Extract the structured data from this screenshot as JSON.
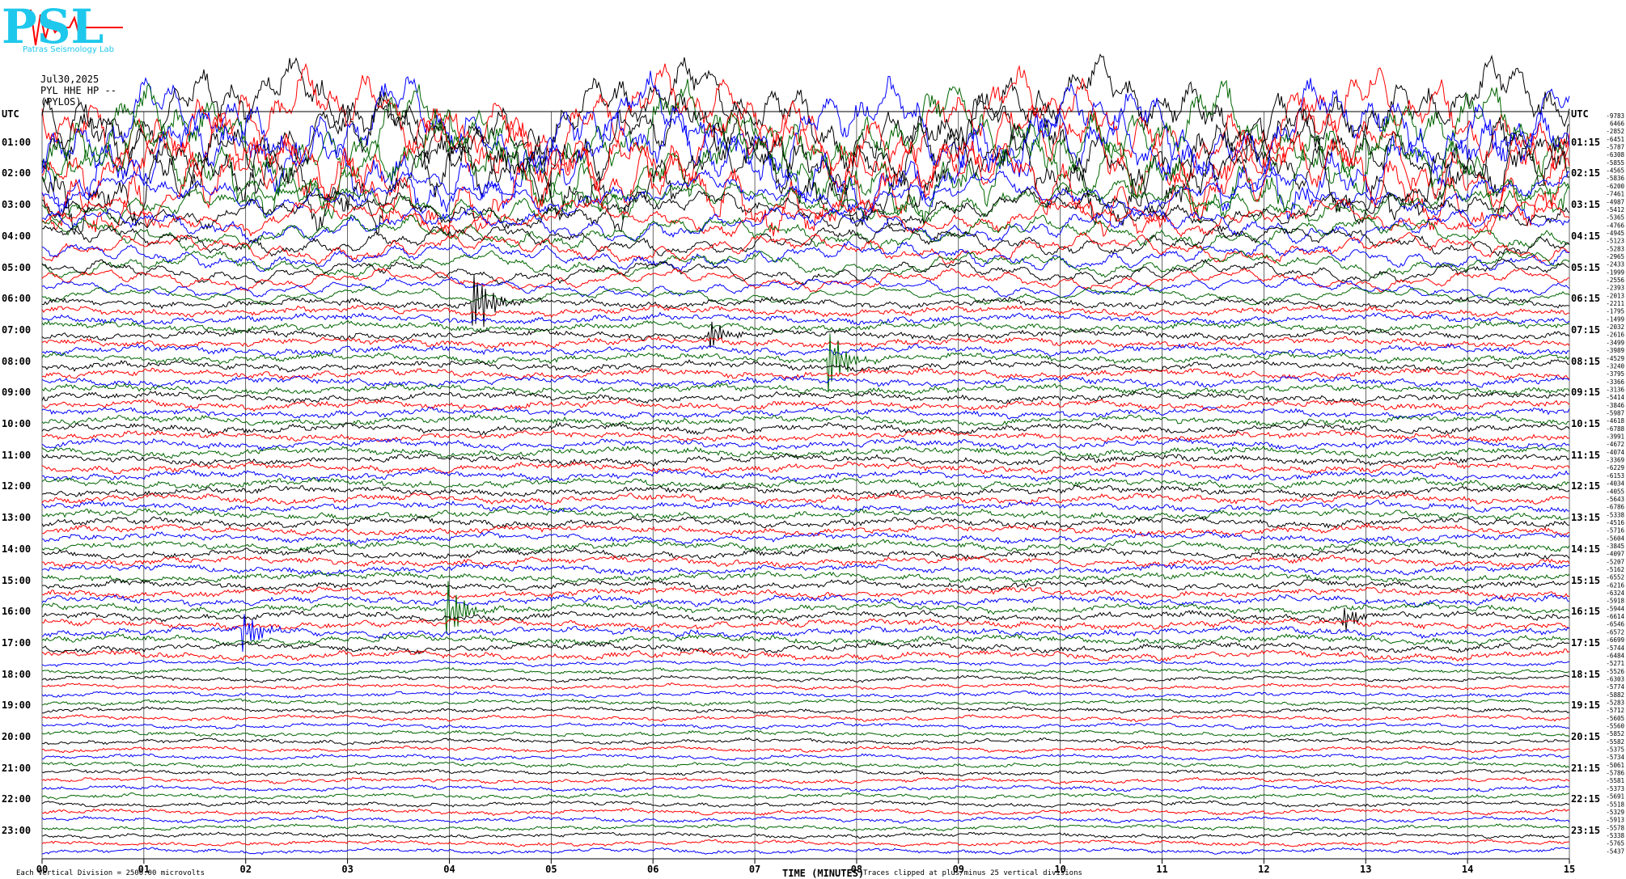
{
  "header": {
    "logo_text": "PSL",
    "logo_sub": "Patras Seismology Lab",
    "date": "Jul30,2025",
    "station": "PYL HHE HP --",
    "location": "(PYLOS)",
    "utc_left": "UTC",
    "utc_right": "UTC"
  },
  "footer": {
    "scale_note": "Each Vertical Division = 2500.00 microvolts",
    "clip_note": "Traces clipped at plus/minus 25 vertical divisions",
    "x_title": "TIME (MINUTES)"
  },
  "colors": {
    "black": "#000000",
    "red": "#ff0000",
    "blue": "#0000ff",
    "green": "#006600",
    "logo": "#1ec8ec",
    "grid": "#000000"
  },
  "chart_data": {
    "type": "line",
    "subtype": "helicorder",
    "x_ticks": [
      "00",
      "01",
      "02",
      "03",
      "04",
      "05",
      "06",
      "07",
      "08",
      "09",
      "10",
      "11",
      "12",
      "13",
      "14",
      "15"
    ],
    "xlim": [
      0,
      15
    ],
    "left_hour_labels": [
      "01:00",
      "02:00",
      "03:00",
      "04:00",
      "05:00",
      "06:00",
      "07:00",
      "08:00",
      "09:00",
      "10:00",
      "11:00",
      "12:00",
      "13:00",
      "14:00",
      "15:00",
      "16:00",
      "17:00",
      "18:00",
      "19:00",
      "20:00",
      "21:00",
      "22:00",
      "23:00"
    ],
    "right_hour_labels": [
      "01:15",
      "02:15",
      "03:15",
      "04:15",
      "05:15",
      "06:15",
      "07:15",
      "08:15",
      "09:15",
      "10:15",
      "11:15",
      "12:15",
      "13:15",
      "14:15",
      "15:15",
      "16:15",
      "17:15",
      "18:15",
      "19:15",
      "20:15",
      "21:15",
      "22:15",
      "23:15"
    ],
    "trace_colors": [
      "black",
      "red",
      "blue",
      "green"
    ],
    "trace_offsets": [
      -9783,
      6466,
      -2852,
      -6451,
      -5787,
      -6308,
      -5855,
      -4565,
      -5836,
      -6200,
      -7461,
      -4987,
      -5412,
      -5365,
      -4766,
      -4945,
      -5123,
      -5283,
      -2965,
      -2433,
      -1999,
      -2556,
      -2393,
      -2013,
      -2211,
      -1795,
      -1499,
      -2032,
      -2616,
      -3499,
      -3989,
      -4529,
      -3240,
      -3795,
      -3366,
      -3136,
      -5414,
      -3846,
      -5987,
      -4618,
      -6788,
      -3991,
      -4672,
      -4074,
      -3369,
      -6229,
      -6153,
      -4034,
      -4055,
      -5643,
      -6786,
      -5338,
      -4516,
      -5716,
      -5604,
      -3845,
      -4097,
      -5207,
      -5162,
      -6552,
      -6216,
      -6324,
      -5918,
      -5944,
      -6614,
      -6546,
      -6572,
      -6699,
      -5744,
      -6484,
      -5271,
      -5526,
      -6303,
      -5774,
      -5882,
      -5283,
      -5712,
      -5605,
      -5560,
      -5852,
      -5582,
      -5375,
      -5734,
      -5061,
      -5786,
      -5581,
      -5373,
      -5691,
      -5518,
      -5329,
      -5913,
      -5578,
      -5338,
      -5765,
      -5437
    ],
    "events": [
      {
        "trace": 24,
        "minute": 4.25,
        "amplitude": 3.0
      },
      {
        "trace": 28,
        "minute": 6.55,
        "amplitude": 1.2
      },
      {
        "trace": 31,
        "minute": 7.75,
        "amplitude": 2.4
      },
      {
        "trace": 63,
        "minute": 4.0,
        "amplitude": 2.2
      },
      {
        "trace": 66,
        "minute": 2.0,
        "amplitude": 1.6
      },
      {
        "trace": 64,
        "minute": 12.8,
        "amplitude": 1.0
      }
    ]
  }
}
